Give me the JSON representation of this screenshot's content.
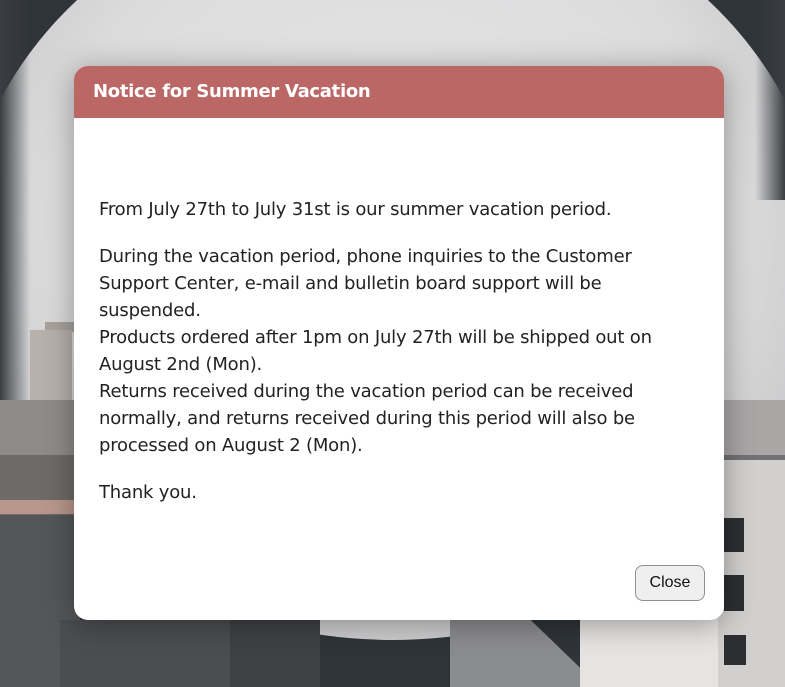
{
  "modal": {
    "title": "Notice for Summer Vacation",
    "paragraphs": {
      "p1": "From July 27th to July 31st is our summer vacation period.",
      "p2_line1": "During the vacation period, phone inquiries to the Customer Support Center, e-mail and bulletin board support will be suspended.",
      "p2_line2": "Products ordered after 1pm on July 27th will be shipped out on August 2nd (Mon).",
      "p2_line3": "Returns received during the vacation period can be received normally, and returns received during this period will also be processed on August 2 (Mon).",
      "p3": "Thank you."
    },
    "close_label": "Close"
  },
  "colors": {
    "header": "#bb6766",
    "modal_bg": "#ffffff",
    "text": "#222222"
  }
}
